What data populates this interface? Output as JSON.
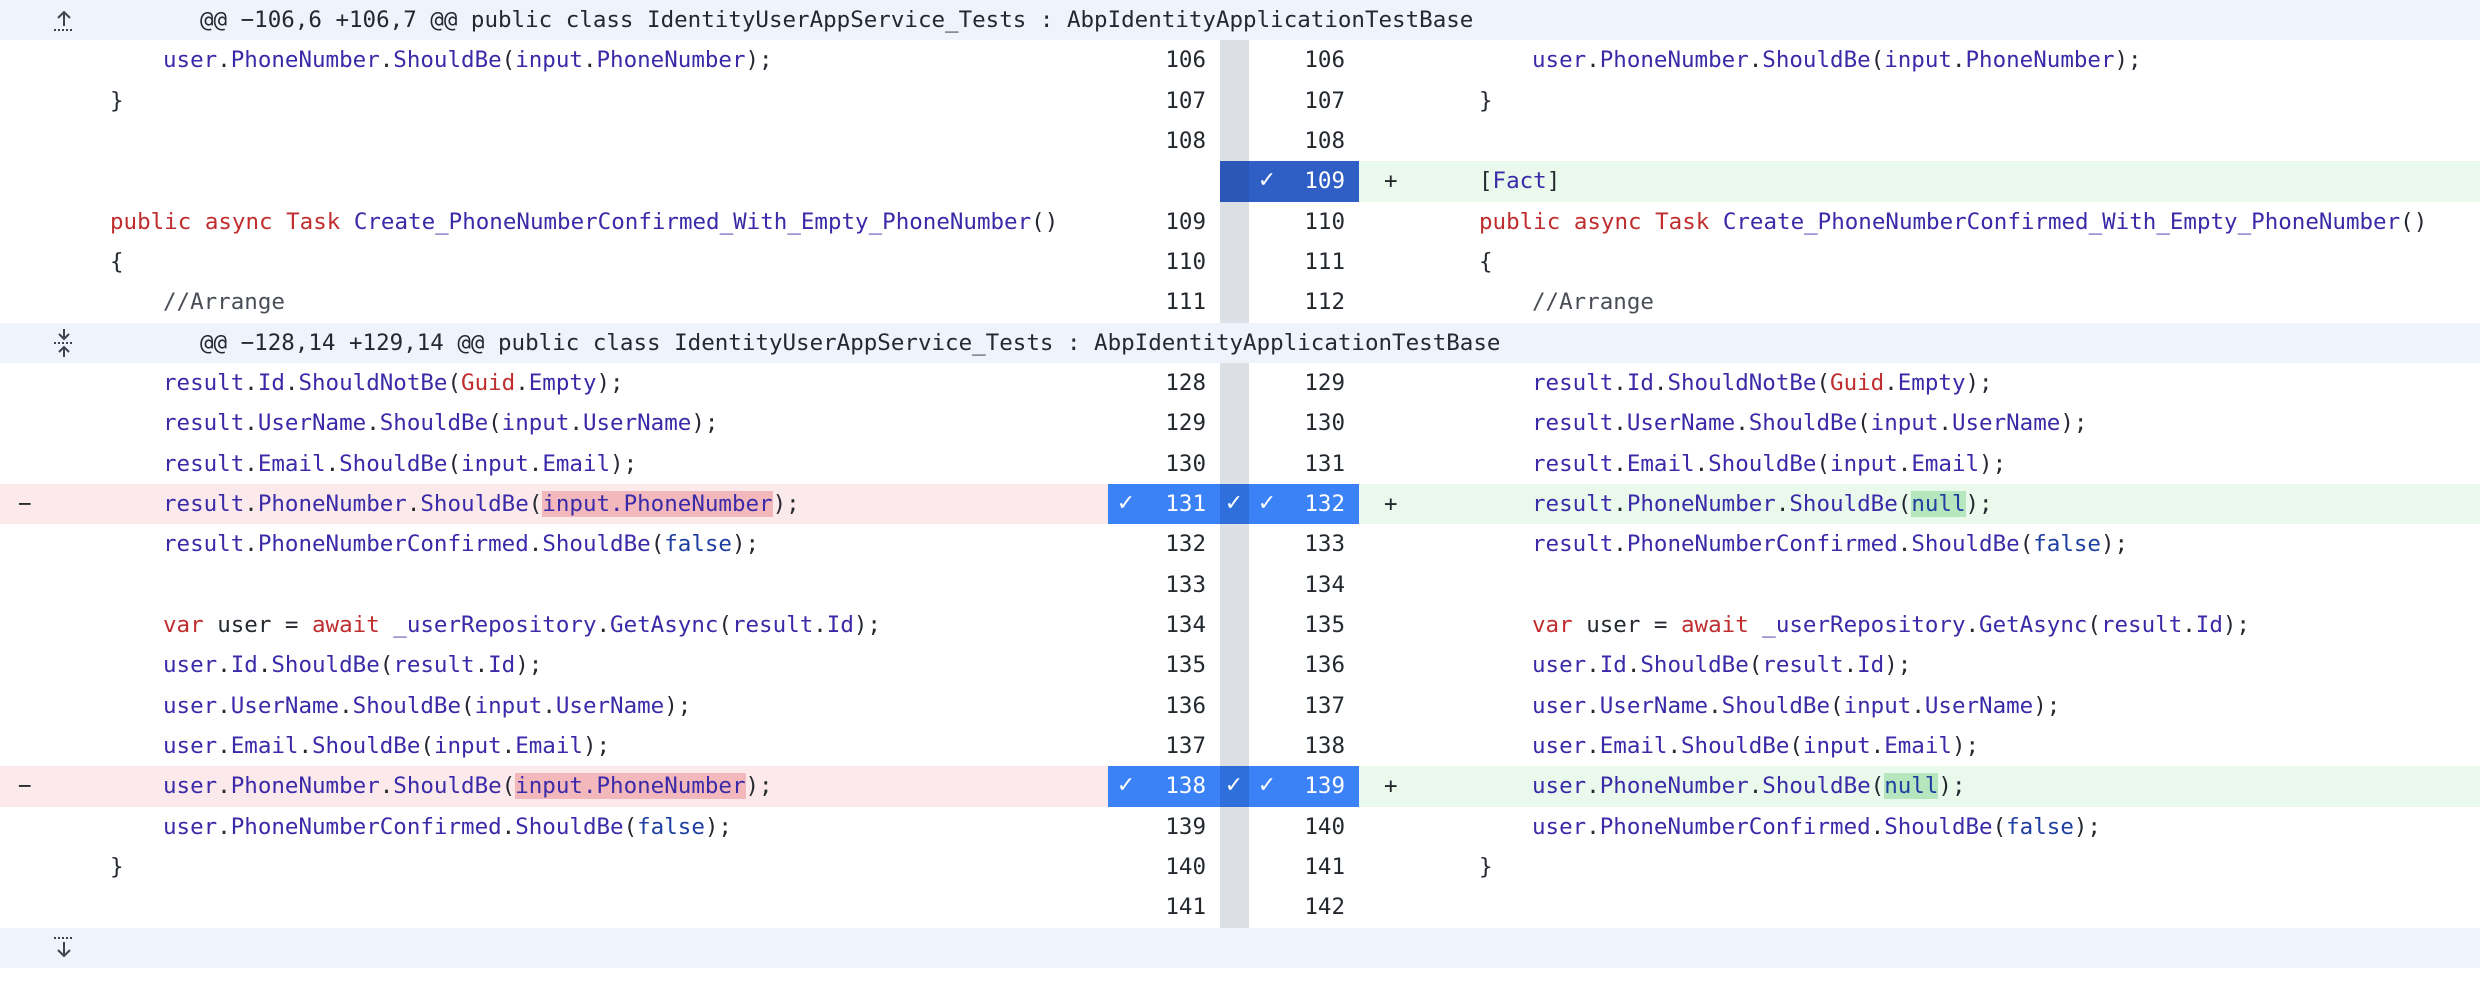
{
  "hunks": [
    {
      "header": "@@ −106,6 +106,7 @@ public class IdentityUserAppService_Tests : AbpIdentityApplicationTestBase",
      "icon": "expand-up-icon"
    },
    {
      "header": "@@ −128,14 +129,14 @@ public class IdentityUserAppService_Tests : AbpIdentityApplicationTestBase",
      "icon": "expand-both-icon"
    },
    {
      "icon": "expand-down-icon"
    }
  ],
  "rows": [
    {
      "left_no": "106",
      "right_no": "106",
      "indent": 1,
      "tokens": [
        [
          "id",
          "user"
        ],
        [
          "pl",
          "."
        ],
        [
          "id",
          "PhoneNumber"
        ],
        [
          "pl",
          "."
        ],
        [
          "id",
          "ShouldBe"
        ],
        [
          "pl",
          "("
        ],
        [
          "id",
          "input"
        ],
        [
          "pl",
          "."
        ],
        [
          "id",
          "PhoneNumber"
        ],
        [
          "pl",
          ");"
        ]
      ]
    },
    {
      "left_no": "107",
      "right_no": "107",
      "indent": 0,
      "tokens": [
        [
          "pl",
          "}"
        ]
      ]
    },
    {
      "left_no": "108",
      "right_no": "108",
      "indent": 0,
      "tokens": []
    },
    {
      "left_no": "",
      "right_no": "109",
      "type": "add-only",
      "indent": 0,
      "right_tokens": [
        [
          "pl",
          "["
        ],
        [
          "id",
          "Fact"
        ],
        [
          "pl",
          "]"
        ]
      ],
      "right_sign": "+"
    },
    {
      "left_no": "109",
      "right_no": "110",
      "indent": 0,
      "tokens": [
        [
          "kw",
          "public "
        ],
        [
          "kw",
          "async "
        ],
        [
          "ty",
          "Task "
        ],
        [
          "id",
          "Create_PhoneNumberConfirmed_With_Empty_PhoneNumber"
        ],
        [
          "pl",
          "()"
        ]
      ]
    },
    {
      "left_no": "110",
      "right_no": "111",
      "indent": 0,
      "tokens": [
        [
          "pl",
          "{"
        ]
      ]
    },
    {
      "left_no": "111",
      "right_no": "112",
      "indent": 1,
      "tokens": [
        [
          "cm",
          "//Arrange"
        ]
      ]
    },
    {
      "left_no": "128",
      "right_no": "129",
      "indent": 1,
      "tokens": [
        [
          "id",
          "result"
        ],
        [
          "pl",
          "."
        ],
        [
          "id",
          "Id"
        ],
        [
          "pl",
          "."
        ],
        [
          "id",
          "ShouldNotBe"
        ],
        [
          "pl",
          "("
        ],
        [
          "ty",
          "Guid"
        ],
        [
          "pl",
          "."
        ],
        [
          "id",
          "Empty"
        ],
        [
          "pl",
          ");"
        ]
      ]
    },
    {
      "left_no": "129",
      "right_no": "130",
      "indent": 1,
      "tokens": [
        [
          "id",
          "result"
        ],
        [
          "pl",
          "."
        ],
        [
          "id",
          "UserName"
        ],
        [
          "pl",
          "."
        ],
        [
          "id",
          "ShouldBe"
        ],
        [
          "pl",
          "("
        ],
        [
          "id",
          "input"
        ],
        [
          "pl",
          "."
        ],
        [
          "id",
          "UserName"
        ],
        [
          "pl",
          ");"
        ]
      ]
    },
    {
      "left_no": "130",
      "right_no": "131",
      "indent": 1,
      "tokens": [
        [
          "id",
          "result"
        ],
        [
          "pl",
          "."
        ],
        [
          "id",
          "Email"
        ],
        [
          "pl",
          "."
        ],
        [
          "id",
          "ShouldBe"
        ],
        [
          "pl",
          "("
        ],
        [
          "id",
          "input"
        ],
        [
          "pl",
          "."
        ],
        [
          "id",
          "Email"
        ],
        [
          "pl",
          ");"
        ]
      ]
    },
    {
      "left_no": "131",
      "right_no": "132",
      "type": "change",
      "indent": 1,
      "left_sign": "−",
      "right_sign": "+",
      "left_tokens": [
        [
          "id",
          "result"
        ],
        [
          "pl",
          "."
        ],
        [
          "id",
          "PhoneNumber"
        ],
        [
          "pl",
          "."
        ],
        [
          "id",
          "ShouldBe"
        ],
        [
          "pl",
          "("
        ],
        [
          "hldel",
          "input.PhoneNumber"
        ],
        [
          "pl",
          ");"
        ]
      ],
      "right_tokens": [
        [
          "id",
          "result"
        ],
        [
          "pl",
          "."
        ],
        [
          "id",
          "PhoneNumber"
        ],
        [
          "pl",
          "."
        ],
        [
          "id",
          "ShouldBe"
        ],
        [
          "pl",
          "("
        ],
        [
          "hladd",
          "null"
        ],
        [
          "pl",
          ");"
        ]
      ]
    },
    {
      "left_no": "132",
      "right_no": "133",
      "indent": 1,
      "tokens": [
        [
          "id",
          "result"
        ],
        [
          "pl",
          "."
        ],
        [
          "id",
          "PhoneNumberConfirmed"
        ],
        [
          "pl",
          "."
        ],
        [
          "id",
          "ShouldBe"
        ],
        [
          "pl",
          "("
        ],
        [
          "lit",
          "false"
        ],
        [
          "pl",
          ");"
        ]
      ]
    },
    {
      "left_no": "133",
      "right_no": "134",
      "indent": 0,
      "tokens": []
    },
    {
      "left_no": "134",
      "right_no": "135",
      "indent": 1,
      "tokens": [
        [
          "kw",
          "var "
        ],
        [
          "pl",
          "user = "
        ],
        [
          "kw",
          "await "
        ],
        [
          "id",
          "_userRepository"
        ],
        [
          "pl",
          "."
        ],
        [
          "id",
          "GetAsync"
        ],
        [
          "pl",
          "("
        ],
        [
          "id",
          "result"
        ],
        [
          "pl",
          "."
        ],
        [
          "id",
          "Id"
        ],
        [
          "pl",
          ");"
        ]
      ]
    },
    {
      "left_no": "135",
      "right_no": "136",
      "indent": 1,
      "tokens": [
        [
          "id",
          "user"
        ],
        [
          "pl",
          "."
        ],
        [
          "id",
          "Id"
        ],
        [
          "pl",
          "."
        ],
        [
          "id",
          "ShouldBe"
        ],
        [
          "pl",
          "("
        ],
        [
          "id",
          "result"
        ],
        [
          "pl",
          "."
        ],
        [
          "id",
          "Id"
        ],
        [
          "pl",
          ");"
        ]
      ]
    },
    {
      "left_no": "136",
      "right_no": "137",
      "indent": 1,
      "tokens": [
        [
          "id",
          "user"
        ],
        [
          "pl",
          "."
        ],
        [
          "id",
          "UserName"
        ],
        [
          "pl",
          "."
        ],
        [
          "id",
          "ShouldBe"
        ],
        [
          "pl",
          "("
        ],
        [
          "id",
          "input"
        ],
        [
          "pl",
          "."
        ],
        [
          "id",
          "UserName"
        ],
        [
          "pl",
          ");"
        ]
      ]
    },
    {
      "left_no": "137",
      "right_no": "138",
      "indent": 1,
      "tokens": [
        [
          "id",
          "user"
        ],
        [
          "pl",
          "."
        ],
        [
          "id",
          "Email"
        ],
        [
          "pl",
          "."
        ],
        [
          "id",
          "ShouldBe"
        ],
        [
          "pl",
          "("
        ],
        [
          "id",
          "input"
        ],
        [
          "pl",
          "."
        ],
        [
          "id",
          "Email"
        ],
        [
          "pl",
          ");"
        ]
      ]
    },
    {
      "left_no": "138",
      "right_no": "139",
      "type": "change",
      "indent": 1,
      "left_sign": "−",
      "right_sign": "+",
      "left_tokens": [
        [
          "id",
          "user"
        ],
        [
          "pl",
          "."
        ],
        [
          "id",
          "PhoneNumber"
        ],
        [
          "pl",
          "."
        ],
        [
          "id",
          "ShouldBe"
        ],
        [
          "pl",
          "("
        ],
        [
          "hldel",
          "input.PhoneNumber"
        ],
        [
          "pl",
          ");"
        ]
      ],
      "right_tokens": [
        [
          "id",
          "user"
        ],
        [
          "pl",
          "."
        ],
        [
          "id",
          "PhoneNumber"
        ],
        [
          "pl",
          "."
        ],
        [
          "id",
          "ShouldBe"
        ],
        [
          "pl",
          "("
        ],
        [
          "hladd",
          "null"
        ],
        [
          "pl",
          ");"
        ]
      ]
    },
    {
      "left_no": "139",
      "right_no": "140",
      "indent": 1,
      "tokens": [
        [
          "id",
          "user"
        ],
        [
          "pl",
          "."
        ],
        [
          "id",
          "PhoneNumberConfirmed"
        ],
        [
          "pl",
          "."
        ],
        [
          "id",
          "ShouldBe"
        ],
        [
          "pl",
          "("
        ],
        [
          "lit",
          "false"
        ],
        [
          "pl",
          ");"
        ]
      ]
    },
    {
      "left_no": "140",
      "right_no": "141",
      "indent": 0,
      "tokens": [
        [
          "pl",
          "}"
        ]
      ]
    },
    {
      "left_no": "141",
      "right_no": "142",
      "indent": 0,
      "tokens": []
    }
  ],
  "colors": {
    "hunk_bg": "#eef3fc",
    "deleted_bg": "#fbe9eb",
    "added_bg": "#e9f9ec",
    "selected": "#3b82f6",
    "keyword": "#c02d2e",
    "identifier": "#3a2aa8",
    "literal": "#1e3fa0"
  }
}
